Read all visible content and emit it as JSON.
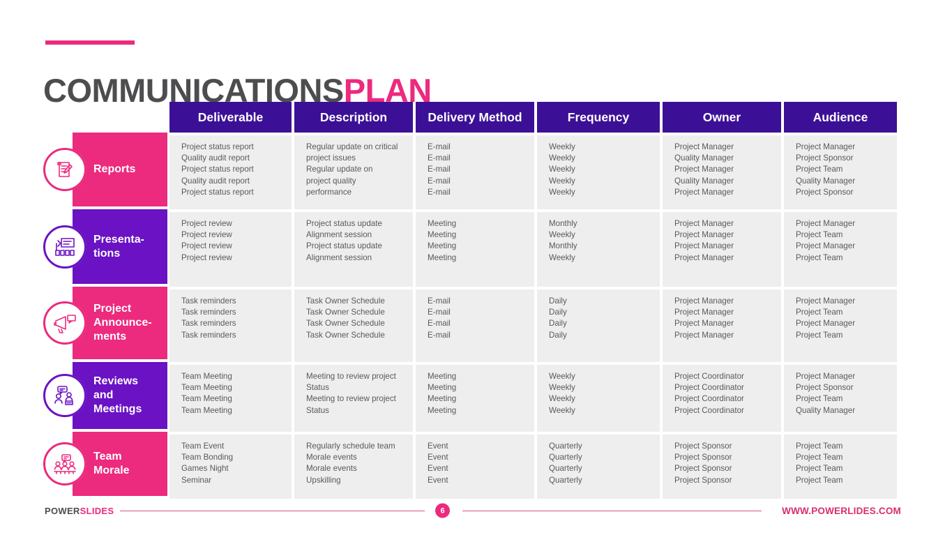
{
  "title": {
    "main": "COMMUNICATIONS",
    "accent": "PLAN"
  },
  "colors": {
    "accent_pink": "#ec2a7e",
    "accent_purple": "#6a12c4",
    "header_purple": "#3c1096",
    "title_gray": "#4d4d4f",
    "cell_bg": "#eeeeee",
    "cell_text": "#58595b"
  },
  "table": {
    "headers": [
      "Deliverable",
      "Description",
      "Delivery Method",
      "Frequency",
      "Owner",
      "Audience"
    ],
    "rows": [
      {
        "category": "Reports",
        "category_color": "#ec2a7e",
        "icon": "report-document-pen-icon",
        "cells": [
          [
            "Project status report",
            "Quality audit report",
            "Project status report",
            "Quality audit report",
            "Project status report"
          ],
          [
            "Regular update on critical",
            "project issues",
            "Regular update on",
            "project quality",
            "performance"
          ],
          [
            "E-mail",
            "E-mail",
            "E-mail",
            "E-mail",
            "E-mail"
          ],
          [
            "Weekly",
            "Weekly",
            "Weekly",
            "Weekly",
            "Weekly"
          ],
          [
            "Project Manager",
            "Quality Manager",
            "Project Manager",
            "Quality Manager",
            "Project Manager"
          ],
          [
            "Project Manager",
            "Project Sponsor",
            "Project Team",
            "Quality Manager",
            "Project Sponsor"
          ]
        ]
      },
      {
        "category": "Presenta-\ntions",
        "category_color": "#6a12c4",
        "icon": "presentation-board-icon",
        "cells": [
          [
            "Project review",
            "Project review",
            "Project review",
            "Project review"
          ],
          [
            "Project status update",
            "Alignment session",
            "Project status update",
            "Alignment session"
          ],
          [
            "Meeting",
            "Meeting",
            "Meeting",
            "Meeting"
          ],
          [
            "Monthly",
            "Weekly",
            "Monthly",
            "Weekly"
          ],
          [
            "Project Manager",
            "Project Manager",
            "Project Manager",
            "Project Manager"
          ],
          [
            "Project Manager",
            "Project Team",
            "Project Manager",
            "Project Team"
          ]
        ]
      },
      {
        "category": "Project\nAnnounce-\nments",
        "category_color": "#ec2a7e",
        "icon": "megaphone-announcement-icon",
        "cells": [
          [
            "Task reminders",
            "Task reminders",
            "Task reminders",
            "Task reminders"
          ],
          [
            "Task Owner Schedule",
            "Task Owner Schedule",
            "Task Owner Schedule",
            "Task Owner Schedule"
          ],
          [
            "E-mail",
            "E-mail",
            "E-mail",
            "E-mail"
          ],
          [
            "Daily",
            "Daily",
            "Daily",
            "Daily"
          ],
          [
            "Project Manager",
            "Project Manager",
            "Project Manager",
            "Project Manager"
          ],
          [
            "Project Manager",
            "Project Team",
            "Project Manager",
            "Project Team"
          ]
        ]
      },
      {
        "category": "Reviews\nand\nMeetings",
        "category_color": "#6a12c4",
        "icon": "people-meeting-chat-icon",
        "cells": [
          [
            "Team Meeting",
            "Team Meeting",
            "Team Meeting",
            "Team Meeting"
          ],
          [
            "Meeting to review project",
            "Status",
            "Meeting to review project",
            "Status"
          ],
          [
            "Meeting",
            "Meeting",
            "Meeting",
            "Meeting"
          ],
          [
            "Weekly",
            "Weekly",
            "Weekly",
            "Weekly"
          ],
          [
            "Project Coordinator",
            "Project Coordinator",
            "Project Coordinator",
            "Project Coordinator"
          ],
          [
            "Project Manager",
            "Project Sponsor",
            "Project Team",
            "Quality Manager"
          ]
        ]
      },
      {
        "category": "Team\nMorale",
        "category_color": "#ec2a7e",
        "icon": "team-group-morale-icon",
        "cells": [
          [
            "Team Event",
            "Team Bonding",
            "Games Night",
            "Seminar"
          ],
          [
            "Regularly schedule team",
            "Morale events",
            "Morale events",
            "Upskilling"
          ],
          [
            "Event",
            "Event",
            "Event",
            "Event"
          ],
          [
            "Quarterly",
            "Quarterly",
            "Quarterly",
            "Quarterly"
          ],
          [
            "Project Sponsor",
            "Project Sponsor",
            "Project Sponsor",
            "Project Sponsor"
          ],
          [
            "Project Team",
            "Project Team",
            "Project Team",
            "Project Team"
          ]
        ]
      }
    ]
  },
  "footer": {
    "brand_dark": "POWER",
    "brand_accent": "SLIDES",
    "page_number": "6",
    "url": "WWW.POWERLIDES.COM"
  }
}
